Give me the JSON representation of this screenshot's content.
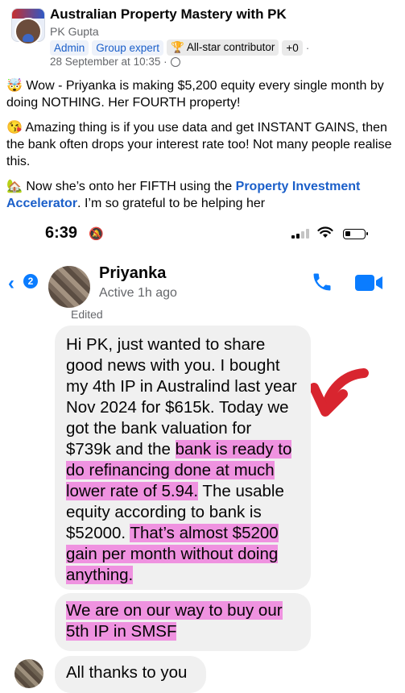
{
  "post": {
    "group_name": "Australian Property Mastery with PK",
    "author": "PK Gupta",
    "badges": [
      "Admin",
      "Group expert",
      "All-star contributor",
      "+0"
    ],
    "timestamp": "28 September at 10:35 ·",
    "paragraphs": [
      "🤯 Wow - Priyanka is making $5,200 equity every single month by doing NOTHING. Her FOURTH property!",
      "😘 Amazing thing is if you use data and get INSTANT GAINS, then the bank often drops your interest rate too! Not many people realise this."
    ],
    "p3_prefix": "🏡 Now she’s onto her FIFTH using the ",
    "p3_link": "Property Investment Accelerator",
    "p3_suffix": ". I’m so grateful to be helping her"
  },
  "phone": {
    "time": "6:39",
    "bell_icon": "bell-off-icon",
    "signal_icon": "signal-icon",
    "wifi_icon": "wifi-icon",
    "battery_icon": "battery-low-icon"
  },
  "chat": {
    "back_count": "2",
    "contact_name": "Priyanka",
    "contact_status": "Active 1h ago",
    "edited_label": "Edited",
    "call_icon": "phone-icon",
    "video_icon": "video-camera-icon",
    "message_1": {
      "plain_a": "Hi PK, just wanted to share good news with you. I bought my 4th IP in Australind last year Nov 2024 for $615k. Today we got the bank valuation for $739k and the ",
      "highlight_a": "bank is ready to do refinancing done at much lower rate of 5.94.",
      "plain_b": " The usable equity according to bank is $52000. ",
      "highlight_b": "That’s almost $5200 gain per month without doing anything."
    },
    "message_2": "We are on our way to buy our 5th IP in SMSF",
    "message_3": "All thanks to you",
    "highlight_color": "#ee6eda",
    "accent_color": "#0a7cff",
    "arrow_color": "#d8252f"
  }
}
